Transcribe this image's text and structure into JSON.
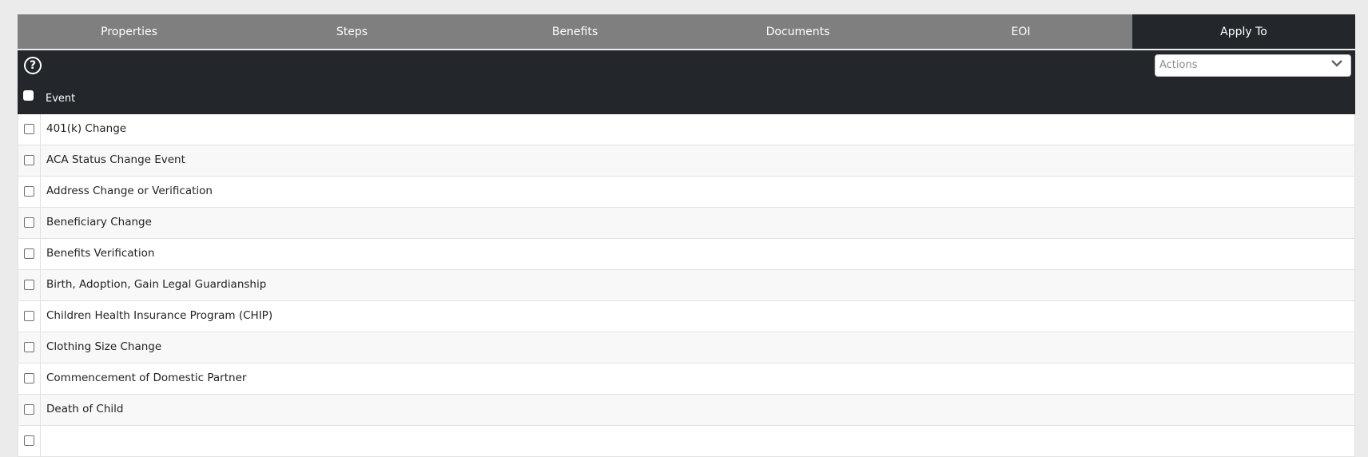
{
  "tabs": [
    {
      "label": "Properties",
      "active": false
    },
    {
      "label": "Steps",
      "active": false
    },
    {
      "label": "Benefits",
      "active": false
    },
    {
      "label": "Documents",
      "active": false
    },
    {
      "label": "EOI",
      "active": false
    },
    {
      "label": "Apply To",
      "active": true
    }
  ],
  "toolbar": {
    "help_icon": "question-circle-icon",
    "help_glyph": "?",
    "actions_placeholder": "Actions",
    "actions_icon": "chevron-down-icon"
  },
  "table": {
    "header_label": "Event",
    "rows": [
      {
        "label": "401(k) Change"
      },
      {
        "label": "ACA Status Change Event"
      },
      {
        "label": "Address Change or Verification"
      },
      {
        "label": "Beneficiary Change"
      },
      {
        "label": "Benefits Verification"
      },
      {
        "label": "Birth, Adoption, Gain Legal Guardianship"
      },
      {
        "label": "Children Health Insurance Program (CHIP)"
      },
      {
        "label": "Clothing Size Change"
      },
      {
        "label": "Commencement of Domestic Partner"
      },
      {
        "label": "Death of Child"
      },
      {
        "label": ""
      }
    ]
  },
  "colors": {
    "tab_bg": "#7f7f7f",
    "dark_bg": "#23272c",
    "page_bg": "#ebebeb"
  }
}
